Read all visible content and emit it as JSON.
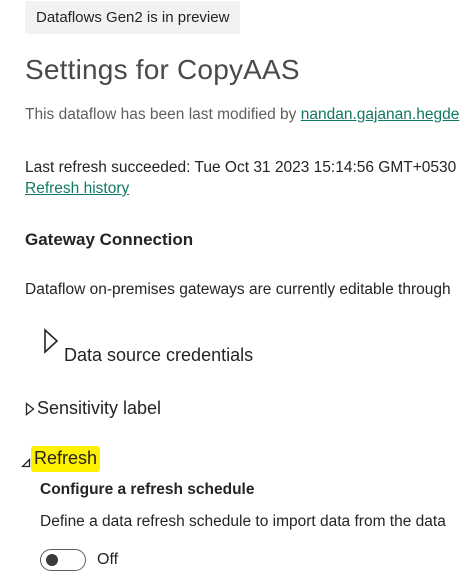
{
  "preview_badge": "Dataflows Gen2 is in preview",
  "page_title": "Settings for CopyAAS",
  "modified": {
    "prefix": "This dataflow has been last modified by ",
    "user": "nandan.gajanan.hegde"
  },
  "last_refresh": "Last refresh succeeded: Tue Oct 31 2023 15:14:56 GMT+0530",
  "refresh_history_link": "Refresh history",
  "gateway": {
    "heading": "Gateway Connection",
    "description": "Dataflow on-premises gateways are currently editable through"
  },
  "sections": {
    "data_source_credentials": "Data source credentials",
    "sensitivity_label": "Sensitivity label",
    "refresh": "Refresh"
  },
  "refresh_schedule": {
    "heading": "Configure a refresh schedule",
    "description": "Define a data refresh schedule to import data from the data",
    "toggle_state": "Off"
  },
  "colors": {
    "link": "#117865",
    "highlight": "#fff200",
    "badge_bg": "#f3f2f1"
  },
  "icons": {
    "data_source_credentials": "chevron-right-outline-icon",
    "sensitivity_label": "chevron-right-outline-icon",
    "refresh": "chevron-down-triangle-icon"
  }
}
